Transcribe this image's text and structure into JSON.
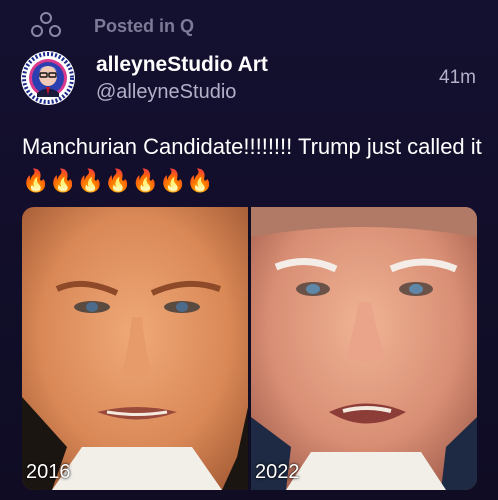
{
  "context": {
    "label": "Posted in Q",
    "icon": "community-circles-icon"
  },
  "author": {
    "display_name": "alleyneStudio Art",
    "handle": "@alleyneStudio",
    "avatar_icon": "avatar"
  },
  "post": {
    "timestamp": "41m",
    "text": "Manchurian Candidate!!!!!!!! Trump just called it🔥🔥🔥🔥🔥🔥🔥"
  },
  "media": {
    "images": [
      {
        "caption": "2016"
      },
      {
        "caption": "2022"
      }
    ]
  },
  "colors": {
    "background": "#0f0c24",
    "muted_text": "#7d7a97",
    "secondary_text": "#b3b0c8",
    "primary_text": "#ffffff"
  }
}
